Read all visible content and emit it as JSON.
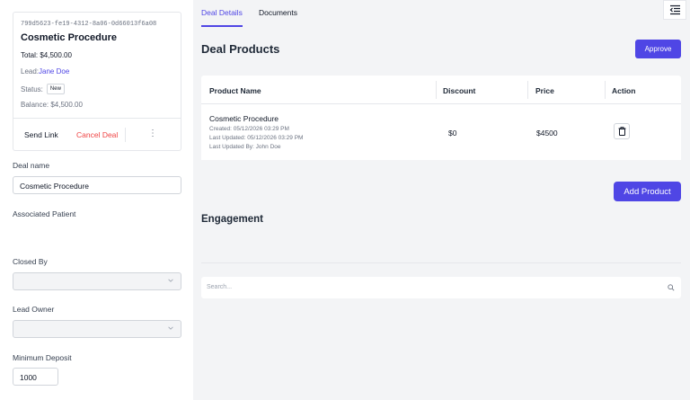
{
  "deal_card": {
    "id": "799d5623-fe19-4312-8a06-0d66013f6a08",
    "title": "Cosmetic Procedure",
    "total": "Total: $4,500.00",
    "lead_label": "Lead:",
    "lead_name": "Jane Doe",
    "status_label": "Status:",
    "status_badge": "New",
    "balance": "Balance: $4,500.00",
    "send_link": "Send Link",
    "cancel_deal": "Cancel Deal",
    "more": "⋮"
  },
  "form": {
    "deal_name_label": "Deal name",
    "deal_name_value": "Cosmetic Procedure",
    "associated_patient_label": "Associated Patient",
    "closed_by_label": "Closed By",
    "lead_owner_label": "Lead Owner",
    "minimum_deposit_label": "Minimum Deposit",
    "minimum_deposit_value": "1000"
  },
  "tabs": [
    {
      "label": "Deal Details",
      "active": true
    },
    {
      "label": "Documents",
      "active": false
    }
  ],
  "products": {
    "heading": "Deal Products",
    "approve_label": "Approve",
    "columns": [
      "Product Name",
      "Discount",
      "Price",
      "Action"
    ],
    "rows": [
      {
        "name": "Cosmetic Procedure",
        "created": "Created: 05/12/2026 03:29 PM",
        "updated": "Last Updated: 05/12/2026 03:29 PM",
        "updated_by": "Last Updated By: John Doe",
        "discount": "$0",
        "price": "$4500"
      }
    ],
    "add_label": "Add Product"
  },
  "engagement": {
    "heading": "Engagement",
    "search_placeholder": "Search..."
  },
  "colors": {
    "accent": "#4f46e5",
    "danger": "#ef4444"
  },
  "icons": [
    "kebab-menu-icon",
    "chevron-down-icon",
    "indent-menu-icon",
    "trash-icon",
    "search-icon"
  ]
}
